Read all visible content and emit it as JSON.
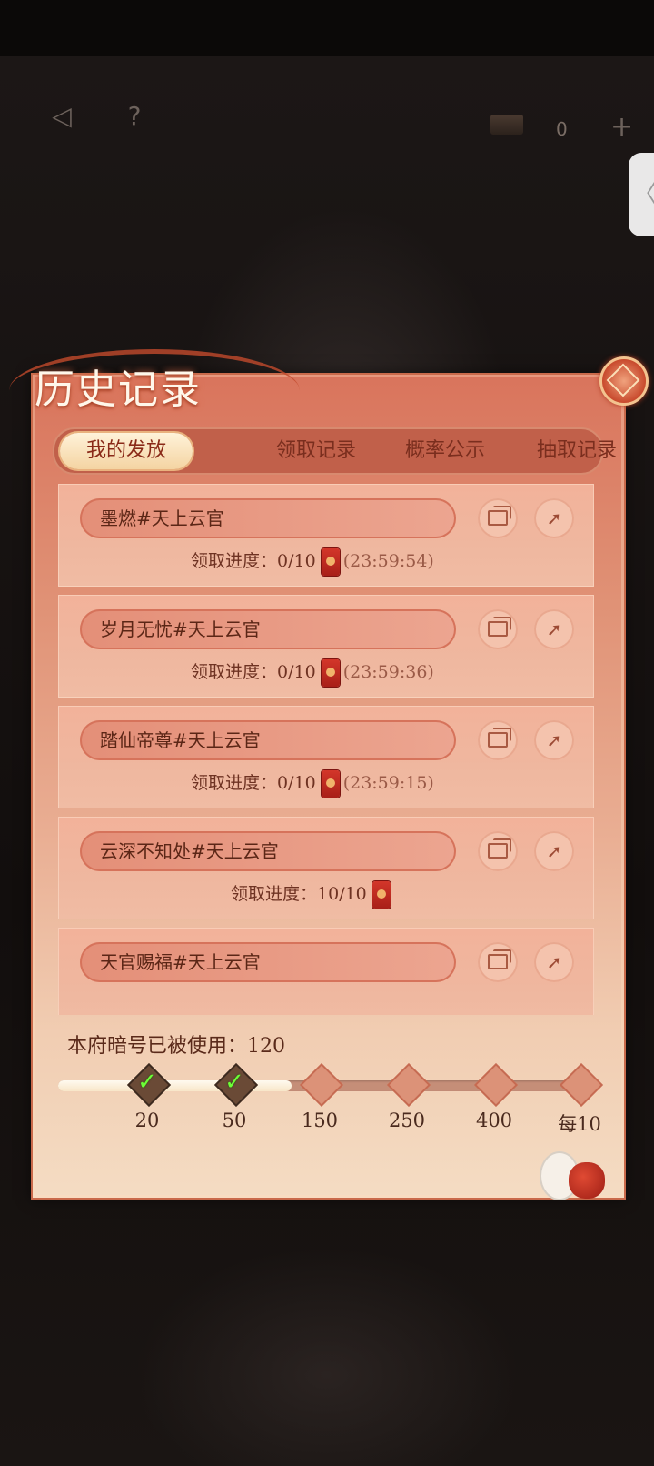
{
  "topbar": {
    "back_icon": "back-arrow-icon",
    "help_label": "?",
    "currency_value": "0",
    "plus_label": "+",
    "side_tab_label": "〈"
  },
  "panel": {
    "title": "历史记录",
    "tabs": [
      {
        "label": "我的发放",
        "active": true
      },
      {
        "label": "领取记录",
        "active": false
      },
      {
        "label": "概率公示",
        "active": false
      },
      {
        "label": "抽取记录",
        "active": false
      }
    ]
  },
  "records": [
    {
      "name": "墨燃#天上云官",
      "progress_label": "领取进度：",
      "progress": "0/10",
      "time": "(23:59:54)"
    },
    {
      "name": "岁月无忧#天上云官",
      "progress_label": "领取进度：",
      "progress": "0/10",
      "time": "(23:59:36)"
    },
    {
      "name": "踏仙帝尊#天上云官",
      "progress_label": "领取进度：",
      "progress": "0/10",
      "time": "(23:59:15)"
    },
    {
      "name": "云深不知处#天上云官",
      "progress_label": "领取进度：",
      "progress": "10/10",
      "time": ""
    },
    {
      "name": "天官赐福#天上云官",
      "progress_label": "",
      "progress": "",
      "time": ""
    }
  ],
  "usage": {
    "label": "本府暗号已被使用：",
    "count": "120",
    "progress_fraction": 0.44,
    "milestones": [
      {
        "label": "20",
        "claimed": true
      },
      {
        "label": "50",
        "claimed": true
      },
      {
        "label": "150",
        "claimed": false
      },
      {
        "label": "250",
        "claimed": false
      },
      {
        "label": "400",
        "claimed": false
      },
      {
        "label": "每10",
        "claimed": false
      }
    ]
  },
  "colors": {
    "panel_top": "#d9745c",
    "panel_bottom": "#f4dcc3",
    "accent_red": "#c24a2c",
    "check_green": "#6cff36"
  }
}
